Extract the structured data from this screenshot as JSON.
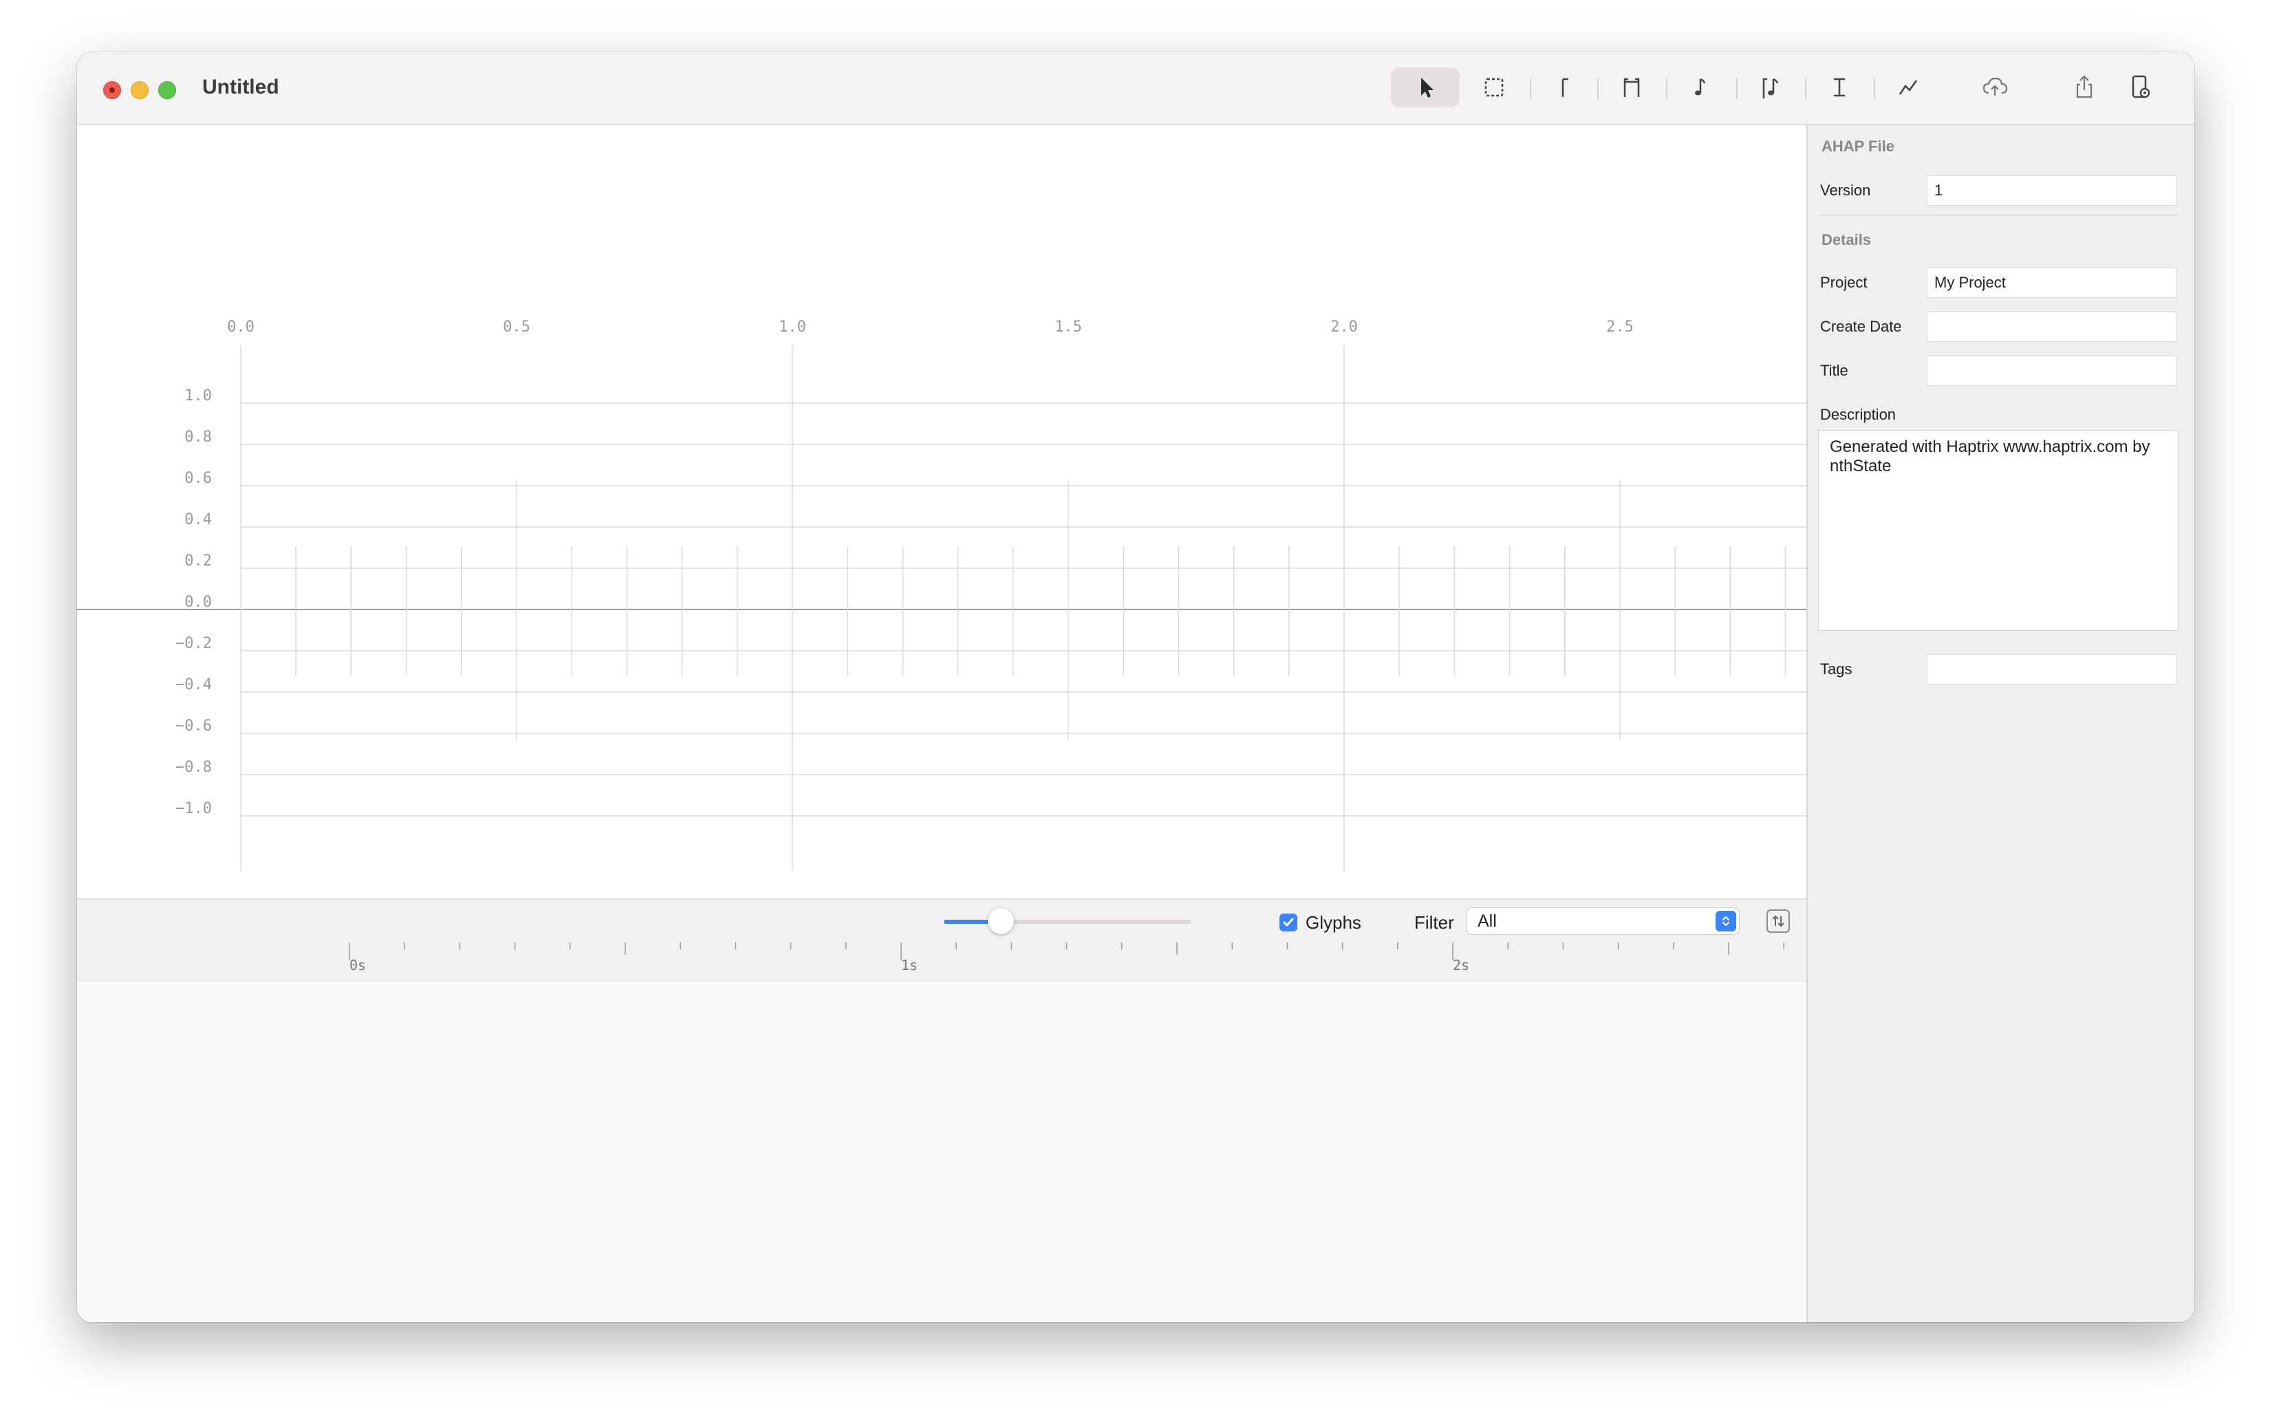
{
  "window": {
    "title": "Untitled"
  },
  "toolbar": {
    "tools": [
      {
        "name": "select-tool",
        "icon": "cursor-arrow-icon",
        "active": true
      },
      {
        "name": "marquee-tool",
        "icon": "dashed-rect-icon"
      },
      {
        "name": "transient-tool",
        "icon": "transient-event-icon"
      },
      {
        "name": "continuous-tool",
        "icon": "continuous-event-icon"
      },
      {
        "name": "audio-tool",
        "icon": "music-note-icon"
      },
      {
        "name": "audio-continuous-tool",
        "icon": "audio-continuous-icon"
      },
      {
        "name": "text-tool",
        "icon": "text-cursor-icon"
      },
      {
        "name": "curve-tool",
        "icon": "curve-icon"
      },
      {
        "name": "cloud-upload-tool",
        "icon": "cloud-upload-icon"
      },
      {
        "name": "share-tool",
        "icon": "share-icon"
      },
      {
        "name": "device-tool",
        "icon": "phone-settings-icon"
      }
    ]
  },
  "timeline": {
    "x_labels": [
      "0.0",
      "0.5",
      "1.0",
      "1.5",
      "2.0",
      "2.5"
    ],
    "y_labels": [
      "1.0",
      "0.8",
      "0.6",
      "0.4",
      "0.2",
      "0.0",
      "−0.2",
      "−0.4",
      "−0.6",
      "−0.8",
      "−1.0"
    ]
  },
  "bottombar": {
    "zoom_level": 0.23,
    "glyphs_label": "Glyphs",
    "glyphs_checked": true,
    "filter_label": "Filter",
    "filter_value": "All"
  },
  "ruler": {
    "labels": [
      "0s",
      "1s",
      "2s"
    ]
  },
  "inspector": {
    "file_section": "AHAP File",
    "version_label": "Version",
    "version_value": "1",
    "details_section": "Details",
    "project_label": "Project",
    "project_value": "My Project",
    "create_date_label": "Create Date",
    "create_date_value": "",
    "title_label": "Title",
    "title_value": "",
    "description_label": "Description",
    "description_value": "Generated with Haptrix www.haptrix.com by nthState",
    "tags_label": "Tags",
    "tags_value": ""
  },
  "colors": {
    "accent": "#3a84f6",
    "close": "#ee5b52",
    "minimize": "#f5bd3f",
    "zoom": "#5ec44f"
  }
}
